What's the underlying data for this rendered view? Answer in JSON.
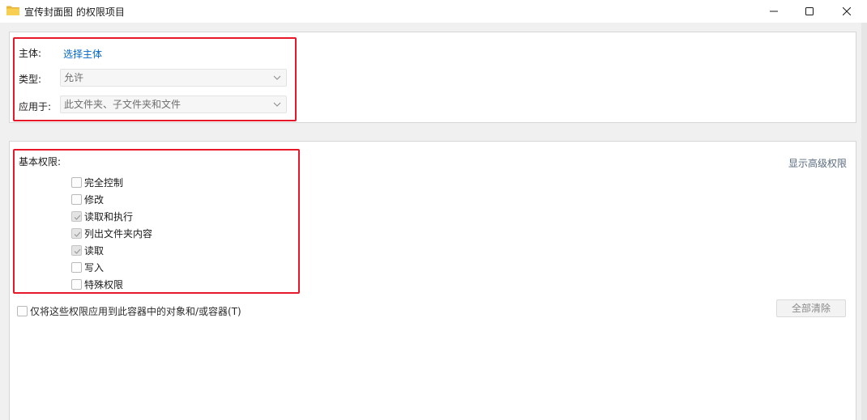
{
  "window": {
    "title": "宣传封面图 的权限项目"
  },
  "principal": {
    "label": "主体:",
    "link": "选择主体"
  },
  "type": {
    "label": "类型:",
    "value": "允许"
  },
  "applies_to": {
    "label": "应用于:",
    "value": "此文件夹、子文件夹和文件"
  },
  "basic_permissions": {
    "label": "基本权限:",
    "show_advanced": "显示高级权限",
    "items": [
      {
        "label": "完全控制",
        "checked": false
      },
      {
        "label": "修改",
        "checked": false
      },
      {
        "label": "读取和执行",
        "checked": true
      },
      {
        "label": "列出文件夹内容",
        "checked": true
      },
      {
        "label": "读取",
        "checked": true
      },
      {
        "label": "写入",
        "checked": false
      },
      {
        "label": "特殊权限",
        "checked": false
      }
    ]
  },
  "apply_only": {
    "label": "仅将这些权限应用到此容器中的对象和/或容器(T)",
    "checked": false
  },
  "clear_all_button": "全部清除",
  "colors": {
    "highlight_border": "#e8182b",
    "link": "#0066cc"
  }
}
